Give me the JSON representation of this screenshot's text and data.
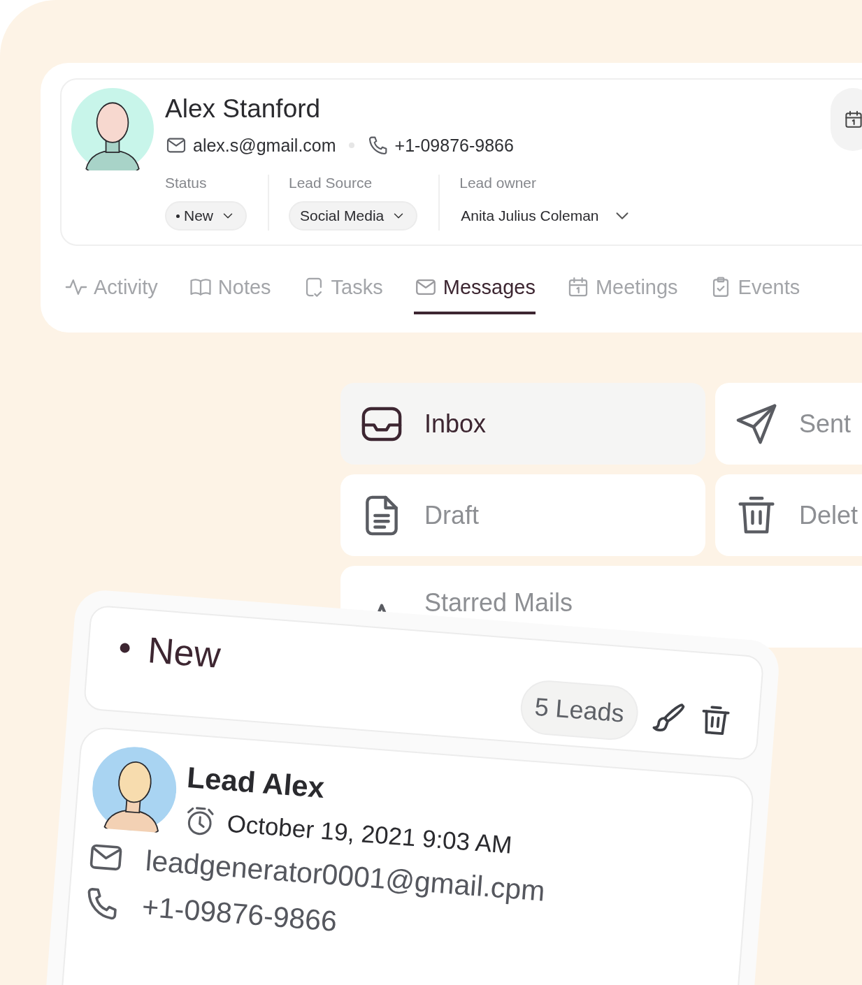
{
  "contact": {
    "name": "Alex Stanford",
    "email": "alex.s@gmail.com",
    "phone": "+1-09876-9866",
    "fields": [
      {
        "label": "Status",
        "value": "New",
        "kind": "status"
      },
      {
        "label": "Lead Source",
        "value": "Social Media",
        "kind": "pill"
      },
      {
        "label": "Lead owner",
        "value": "Anita Julius Coleman",
        "kind": "plain"
      }
    ]
  },
  "tabs": [
    {
      "label": "Activity",
      "selected": false
    },
    {
      "label": "Notes",
      "selected": false
    },
    {
      "label": "Tasks",
      "selected": false
    },
    {
      "label": "Messages",
      "selected": true
    },
    {
      "label": "Meetings",
      "selected": false
    },
    {
      "label": "Events",
      "selected": false
    }
  ],
  "folders": [
    {
      "label": "Inbox",
      "selected": true
    },
    {
      "label": "Sent",
      "selected": false
    },
    {
      "label": "Draft",
      "selected": false
    },
    {
      "label": "Delet",
      "selected": false
    },
    {
      "label": "Starred Mails",
      "selected": false
    }
  ],
  "group": {
    "title": "New",
    "count": "5 Leads"
  },
  "lead": {
    "name": "Lead Alex",
    "date": "October 19, 2021 9:03 AM",
    "email": "leadgenerator0001@gmail.cpm",
    "phone": "+1-09876-9866"
  }
}
